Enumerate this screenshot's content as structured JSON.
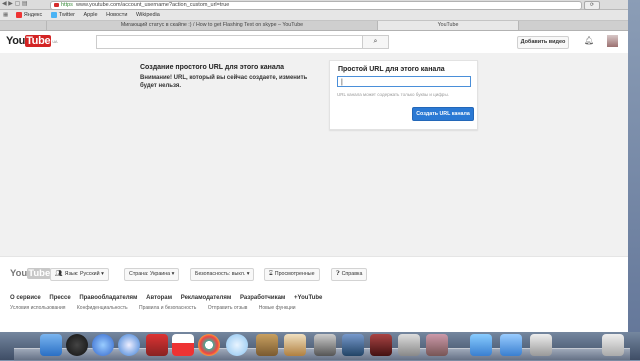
{
  "browser": {
    "url_scheme": "https",
    "url_rest": "www.youtube.com/account_username?action_custom_url=true",
    "bookmarks": [
      "Яндекс",
      "Twitter",
      "Apple",
      "Новости",
      "Wikipedia"
    ],
    "tabs": [
      "Мигающий статус в скайпе :) / How to get Flashing Text on skype – YouTube",
      "YouTube"
    ],
    "active_tab": 1
  },
  "header": {
    "logo_you": "You",
    "logo_tube": "Tube",
    "region": "UA",
    "search_icon": "search-icon",
    "upload_label": "Добавить видео",
    "bell_icon": "bell-icon"
  },
  "main": {
    "title": "Создание простого URL для этого канала",
    "warning": "Внимание! URL, который вы сейчас создаете, изменить будет нельзя.",
    "card": {
      "title": "Простой URL для этого канала",
      "input_value": "",
      "hint": "URL канала может содержать только буквы и цифры.",
      "create_button": "Создать URL канала"
    }
  },
  "footer": {
    "logo_you": "You",
    "logo_tube": "Tube",
    "language": "Язык: Русский",
    "country": "Страна: Украина",
    "safety": "Безопасность: выкл.",
    "history": "Просмотренные",
    "help": "Справка",
    "links": [
      "О сервисе",
      "Прессе",
      "Правообладателям",
      "Авторам",
      "Рекламодателям",
      "Разработчикам",
      "+YouTube"
    ],
    "links2": [
      "Условия использования",
      "Конфиденциальность",
      "Правила и безопасность",
      "Отправить отзыв",
      "Новые функции"
    ]
  },
  "dock": {
    "icons": [
      "finder-icon",
      "dashboard-icon",
      "itunes-icon",
      "safari-icon",
      "photo-booth-icon",
      "calendar-icon",
      "photos-icon",
      "chrome-icon",
      "messages-icon",
      "preview-icon",
      "camera-icon",
      "app-icon",
      "movie-icon",
      "system-preferences-icon",
      "archive-icon",
      "folder-icon",
      "downloads-icon",
      "trash-icon"
    ]
  }
}
